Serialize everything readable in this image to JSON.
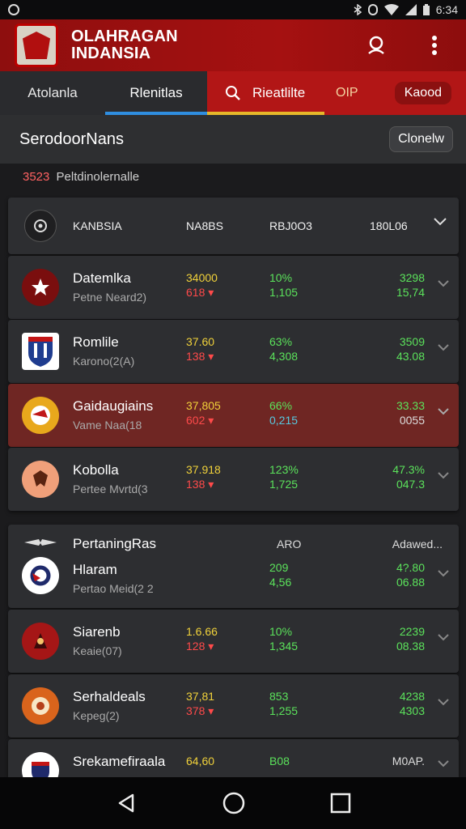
{
  "status_bar": {
    "time": "6:34",
    "left_icon": "record-icon",
    "icons": [
      "bluetooth-icon",
      "alarm-icon",
      "wifi-icon",
      "signal-icon",
      "battery-icon"
    ]
  },
  "app_bar": {
    "title": "OLAHRAGAN INDANSIA",
    "actions": [
      "search-icon",
      "more-vert-icon"
    ]
  },
  "tabs": {
    "tab1": "Atolanla",
    "tab2": "Rlenitlas",
    "search": "Rieatlilte",
    "otp": "OIP",
    "button": "Kaood"
  },
  "section": {
    "title": "SerodoorNans",
    "button": "Clonelw"
  },
  "info": {
    "count": "3523",
    "text": "Peltdinolernalle"
  },
  "table_head": {
    "col1": "KANBSIA",
    "col2": "NA8BS",
    "col3": "RBJ0O3",
    "col4": "180L06"
  },
  "rows": [
    {
      "name": "Datemlka",
      "sub": "Petne Neard2)",
      "y1": "34000",
      "y2": "618",
      "g1": "10%",
      "g2": "1,105",
      "r1": "3298",
      "r2": "15,74"
    },
    {
      "name": "Romlile",
      "sub": "Karono(2(A)",
      "y1": "37.60",
      "y2": "138",
      "g1": "63%",
      "g2": "4,308",
      "r1": "3509",
      "r2": "43.08"
    },
    {
      "name": "Gaidaugiains",
      "sub": "Vame Naa(18",
      "y1": "37,805",
      "y2": "602",
      "g1": "66%",
      "g2": "0,215",
      "r1": "33.33",
      "r2": "0055"
    },
    {
      "name": "Kobolla",
      "sub": "Pertee Mvrtd(3",
      "y1": "37.918",
      "y2": "138",
      "g1": "123%",
      "g2": "1,725",
      "r1": "47.3%",
      "r2": "047.3"
    }
  ],
  "group": {
    "title": "PertaningRas",
    "mid": "ARO",
    "right": "Adawed..."
  },
  "rows2": [
    {
      "name": "Hlaram",
      "sub": "Pertao Meid(2 2",
      "y1": "",
      "y2": "",
      "g1": "209",
      "g2": "4,56",
      "r1": "4?.80",
      "r2": "06.88"
    },
    {
      "name": "Siarenb",
      "sub": "Keaie(07)",
      "y1": "1.6.66",
      "y2": "128",
      "g1": "10%",
      "g2": "1,345",
      "r1": "2239",
      "r2": "08.38"
    },
    {
      "name": "Serhaldeals",
      "sub": "Kepeg(2)",
      "y1": "37,81",
      "y2": "378",
      "g1": "853",
      "g2": "1,255",
      "r1": "4238",
      "r2": "4303"
    },
    {
      "name": "Srekamefiraala",
      "sub": "",
      "y1": "64,60",
      "y2": "",
      "g1": "B08",
      "g2": "",
      "r1": "M0AP.",
      "r2": ""
    }
  ],
  "colors": {
    "brand_red": "#a51111",
    "tab_blue": "#2f8ee0",
    "tab_yellow": "#e6b82a",
    "positive": "#5be25b",
    "highlight": "#f0d13a",
    "negative": "#ff4a4a"
  }
}
